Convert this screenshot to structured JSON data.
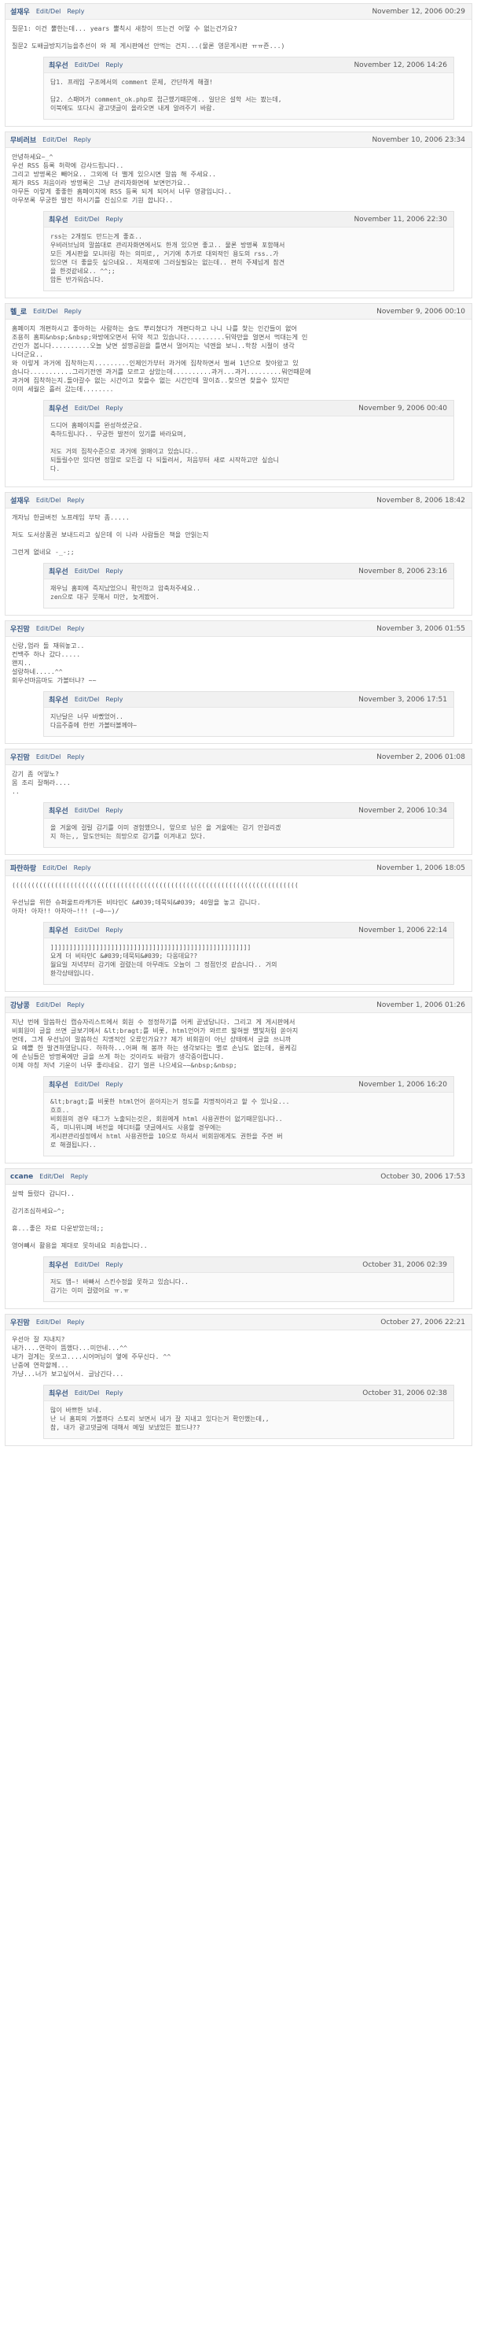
{
  "edit_del_label": "Edit/Del",
  "reply_label": "Reply",
  "comments": [
    {
      "author": "설재우",
      "date": "November 12, 2006 00:29",
      "body": "질문1: 이건 뿔한는데... years 뿔칙시 새창이 뜨는건 어떻 수 없는건가요?\n\n질문2 도배글방지기능을추선이 와 제 게시판에선 안먹는 건지...(물론 영문게시판 ㅠㅠ죤...)",
      "reply": {
        "author": "최우선",
        "date": "November 12, 2006 14:26",
        "body": "답1. 프레임 구조에서의 comment 문제, 간단하게 해결!\n\n답2. 스패머가 comment_ok.php로 접근했기때문에.. 일단은 설학 서는 봤는데,\n이북에도 또다시 광고댓글이 올라오면 내게 알려주기 바람."
      }
    },
    {
      "author": "무비러브",
      "date": "November 10, 2006 23:34",
      "body": "안녕하세요~_^\n우선 RSS 등록 허락에 감사드립니다..\n그리고 방명록은 빼어요.. 그외에 더 밸게 있으시면 말씀 해 주세요..\n제가 RSS 처음이라 방명록은 그냥 관리자화면에 보면먼가요..\n아무튼 이렇게 좋좋한 홈페이지에 RSS 등록 되게 되어서 너무 영광입니다..\n아무쪼록 무궁한 발전 하시기를 진심으로 기원 합니다..",
      "reply": {
        "author": "최우선",
        "date": "November 11, 2006 22:30",
        "body": "rss는 2개정도 만드는게 좋죠..\n우비러브님의 말씀대로 관리자화면에서도 한개 있으면 좋고.. 물론 방명록 포함해서\n모든 게시판을 모니터링 하는 의미로,, 거기에 추가로 대외적인 용도의 rss..가\n있으면 더 좋을듯 싶으네요.. 처재로에 그러실필요는 없는데.. 편히 주제넘게 참견\n을 한것같네요.. ^^;;\n암튼 반가워습니다."
      }
    },
    {
      "author": "헬_로",
      "date": "November 9, 2006 00:10",
      "body": "홈페이지 개편하시고 좋아하는 사람하는 슬도 뿌리쳤다가 개편다하고 나니 나를 찾는 인간들이 없어\n조용히 홈피&nbsp;&nbsp;와방에오면서 뒤약 적고 있습니다..........뒤약만을 얼면서 먹대는게 인\n간인가 봅니다..........오늘 낮면 설명공원을 틀면서 멀어지는 넉엔을 보니..학창 시절이 생각\n나더군요..\n와 이렇게 과거에 집착하는지.........인제인가부터 과거에 집착하면서 벌써 1년으로 찾아왔고 있\n습니다...........그리기전엔 과거를 모르고 살았는데..........과거...과거.........뭐언때문에\n과거에 집착하는지.돌아갈수 없는 시간이고 찾을수 없는 시간인데 말이죠..찾으면 찾을수 있지만\n이미 세월은 흘러 갔는데........",
      "reply": {
        "author": "최우선",
        "date": "November 9, 2006 00:40",
        "body": "드디어 홈페이지를 완성하셨군요.\n축하드립니다.. 무궁한 발전이 있기를 바라요며,\n\n저도 거의 집착수준으로 과거에 얽매이고 있습니다..\n되돌릴수만 있다면 정말로 모든걸 다 되돌려서, 처음부터 새로 시작하고만 싶습니\n다."
      }
    },
    {
      "author": "설재우",
      "date": "November 8, 2006 18:42",
      "body": "개자님 한글버전 노프레임 부탁 좀.....\n\n저도 도서상품권 보내드리고 싶은데 이 나라 사람들은 책을 안읽는지\n\n그런게 없네요 -_-;;",
      "reply": {
        "author": "최우선",
        "date": "November 8, 2006 23:16",
        "body": "재우님 홈피에 즉지났었으니 확인하고 압축처주세요..\nzen으로 대구 뭇해서 미안, 늦게봤어."
      }
    },
    {
      "author": "우진맘",
      "date": "November 3, 2006 01:55",
      "body": "신랑,엄라 돌 재워놓고..\n컨백주 하나 갔다.....\n왠지..\n설랑하네.....^^\n회우선마음마도 가볼터냐? ~~",
      "reply": {
        "author": "최우선",
        "date": "November 3, 2006 17:51",
        "body": "지난달은 너무 바빴었어..\n다음주중에 한번 가볼터볼께야~"
      }
    },
    {
      "author": "우진맘",
      "date": "November 2, 2006 01:08",
      "body": "감기 좀 어떻노?\n몸 조리 잘해라....\n..",
      "reply": {
        "author": "최우선",
        "date": "November 2, 2006 10:34",
        "body": "올 겨울에 걸릴 감기를 이미 경험했으니, 앞으로 남은 올 겨울에는 감기 안걸리겠\n지 하는,, 말도안되는 희망으로 감기를 이겨내고 있다."
      }
    },
    {
      "author": "파란하랑",
      "date": "November 1, 2006 18:05",
      "body": "((((((((((((((((((((((((((((((((((((((((((((((((((((((((((((((((((((((((((\n\n우선님을 위한 슈퍼울트라캐가튼 비타민C &#039;데묵되&#039; 40알을 놓고 갑니다.\n아자! 아자!! 아자아~!!! (~0~~)/",
      "reply": {
        "author": "최우선",
        "date": "November 1, 2006 22:14",
        "body": "]]]]]]]]]]]]]]]]]]]]]]]]]]]]]]]]]]]]]]]]]]]]]]]]]]]]]\n요게 더 비타민C &#039;데묵되&#039; 다옹데요??\n월요일 저녁부터 감기에 걸렸는데 아무래도 오늘이 그 정점인것 같습니다.. 거의\n환각상태입니다."
      }
    },
    {
      "author": "강낭콩",
      "date": "November 1, 2006 01:26",
      "body": "지난 번에 말씀하신 캡슈자리스트에서 회원 수 정정하기를 어케 끝냈답니다. 그리고 게 게시판에서\n비회원이 글을 쓰면 글보기에서 &lt;bragt;를 비롯, html언어가 와르르 밟혀쌀 별빛처럼 쏟아지\n면데, 그게 우선님이 말씀하신 치명적인 오류인가요?? 제가 비회원이 아닌 상태에서 글을 쓰니까\n요 예쁠 한 발견하였답니다. 하하하...어쩌 해 봉까 하는 생각보다는 별로 손님도 없는데, 릉케김\n에 손님들은 방명록에만 글을 쓰게 하는 것이라도 바람가 생각중이랍니다.\n이제 야칭 저녁 기운이 너무 좋리네요. 감기 얼른 나으세요~~&nbsp;&nbsp;",
      "reply": {
        "author": "최우선",
        "date": "November 1, 2006 16:20",
        "body": "&lt;bragt;를 비롯한 html언어 쏟아지는거 정도를 치명적이라고 할 수 있나요...\n흐흐..\n비회원의 경우 태그가 노출되는것은, 회원에게 html 사용권한이 없기때문입니다..\n즉, 미니위니페 버전을 에디터를 댓글에서도 사용할 경우에는\n게시판관리설정에서 html 사용권한을 10으로 하셔서 비회원에게도 권한을 주면 버\n로 해결됩니다.."
      }
    },
    {
      "author": "ccane",
      "date": "October 30, 2006 17:53",
      "body": "살짝 들렀다 갑니다..\n\n감기조심하세요~^;\n\n휴...좋은 자료 다운받았는데;;\n\n영어빼서 활용을 제대로 못하네요 죄송합니다..",
      "reply": {
        "author": "최우선",
        "date": "October 31, 2006 02:39",
        "body": "저도 앱~! 바빠서 스킨수정을 못하고 있습니다..\n감기는 이미 걸렸어요 ㅠ.ㅠ"
      }
    },
    {
      "author": "우진맘",
      "date": "October 27, 2006 22:21",
      "body": "우선아 잘 지내지?\n내가....연락이 뜸했다...미안네...^^\n내가 걸게는 못쓰고....시어머님이 옆에 주무신다. ^^\n난중에 연락할께...\n가냥...너가 보고싶어서. 글남긴다...",
      "reply": {
        "author": "최우선",
        "date": "October 31, 2006 02:38",
        "body": "많이 바쁘한 보네.\n난 너 홈피의 가볼까다 스토리 보면서 네가 잘 지내고 있다는거 확인했는데,,\n참, 내가 광고댓글에 대해서 메일 보냈었든 봤드냐??"
      }
    }
  ]
}
